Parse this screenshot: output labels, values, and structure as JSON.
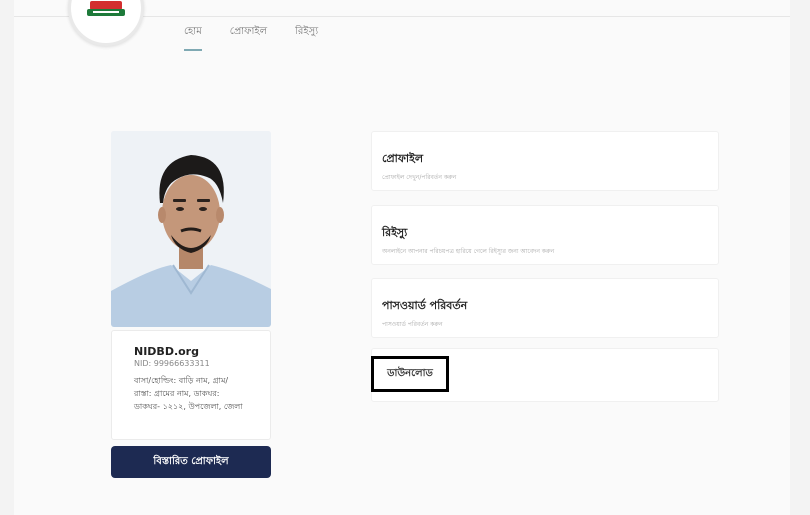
{
  "nav": {
    "items": [
      {
        "label": "হোম",
        "active": true
      },
      {
        "label": "প্রোফাইল",
        "active": false
      },
      {
        "label": "রিইস্যু",
        "active": false
      }
    ]
  },
  "profile": {
    "name": "NIDBD.org",
    "nid": "NID: 99966633311",
    "address_line1": "বাসা/হোল্ডিং: বাড়ি নাম, গ্রাম/",
    "address_line2": "রাস্তা: গ্রামের নাম, ডাকঘর:",
    "address_line3": "ডাকঘর- ১২১২, উপজেলা, জেলা"
  },
  "detail_button": {
    "label": "বিস্তারিত প্রোফাইল"
  },
  "menu": {
    "profile": {
      "title": "প্রোফাইল",
      "subtitle": "প্রোফাইল দেখুন/পরিবর্তন করুন"
    },
    "reissue": {
      "title": "রিইস্যু",
      "subtitle": "অনলাইনে আপনার পরিচয়পত্র হারিয়ে গেলে রিইস্যুর জন্য আবেদন করুন"
    },
    "password": {
      "title": "পাসওয়ার্ড পরিবর্তন",
      "subtitle": "পাসওয়ার্ড পরিবর্তন করুন"
    },
    "download": {
      "title": "ডাউনলোড"
    }
  },
  "colors": {
    "primary_button": "#1d2a52",
    "nav_underline": "#7fa9b3",
    "logo_red": "#d32f2f",
    "logo_green": "#1e7a3a"
  }
}
